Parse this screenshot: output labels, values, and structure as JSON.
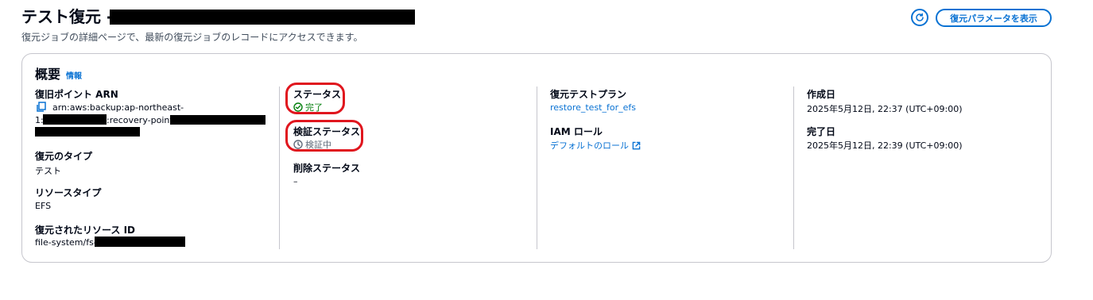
{
  "header": {
    "title": "テスト復元 -",
    "description": "復元ジョブの詳細ページで、最新の復元ジョブのレコードにアクセスできます。",
    "refresh_icon": "refresh-icon",
    "params_button": "復元パラメータを表示"
  },
  "summary": {
    "title": "概要",
    "info": "情報",
    "col1": {
      "arn_label": "復旧ポイント ARN",
      "arn_line1": "arn:aws:backup:ap-northeast-",
      "arn_line2_prefix": "1:",
      "arn_line2_mid": ":recovery-point:",
      "restore_type_label": "復元のタイプ",
      "restore_type_value": "テスト",
      "resource_type_label": "リソースタイプ",
      "resource_type_value": "EFS",
      "restored_id_label": "復元されたリソース ID",
      "restored_id_prefix": "file-system/fs-"
    },
    "col2": {
      "status_label": "ステータス",
      "status_value": "完了",
      "validation_label": "検証ステータス",
      "validation_value": "検証中",
      "deletion_label": "削除ステータス",
      "deletion_value": "–"
    },
    "col3": {
      "plan_label": "復元テストプラン",
      "plan_value": "restore_test_for_efs",
      "iam_label": "IAM ロール",
      "iam_value": "デフォルトのロール"
    },
    "col4": {
      "created_label": "作成日",
      "created_value": "2025年5月12日, 22:37 (UTC+09:00)",
      "completed_label": "完了日",
      "completed_value": "2025年5月12日, 22:39 (UTC+09:00)"
    }
  },
  "colors": {
    "link": "#0972d3",
    "success": "#037f0c",
    "pending": "#5f6b7a",
    "highlight": "#e0161e"
  }
}
